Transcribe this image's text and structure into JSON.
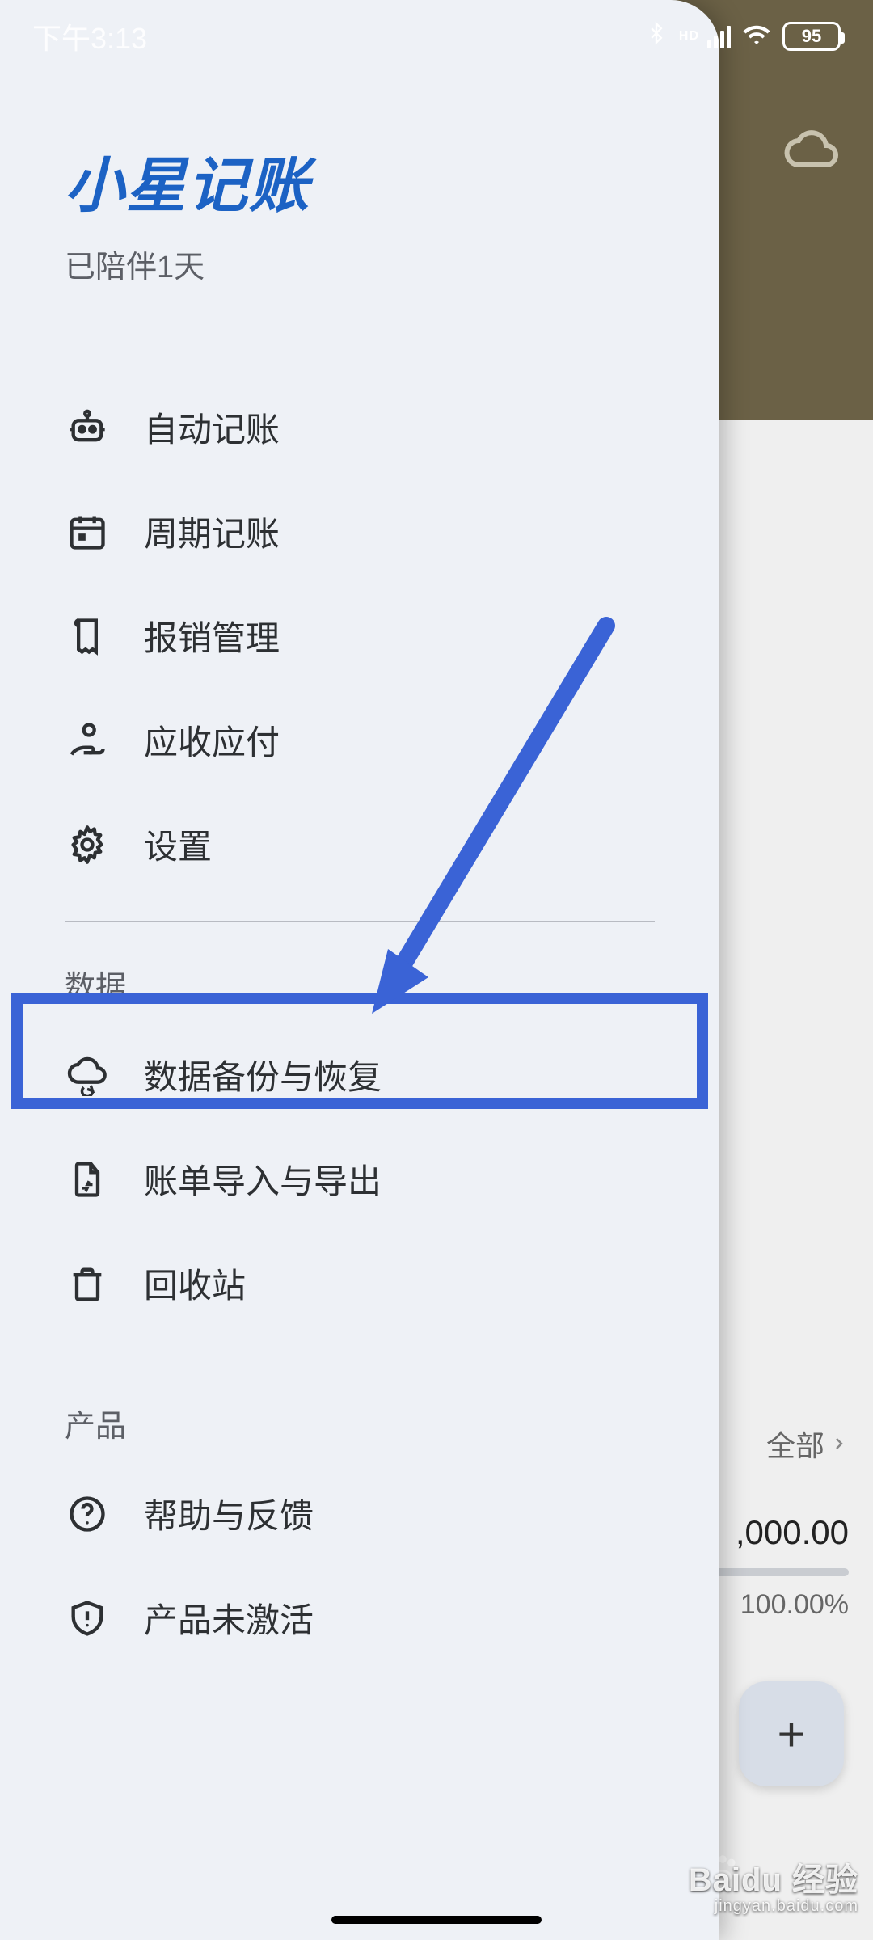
{
  "status": {
    "time": "下午3:13",
    "battery": "95"
  },
  "background": {
    "filter_all": "全部",
    "amount": ",000.00",
    "percent": "100.00%",
    "fab": "+"
  },
  "drawer": {
    "brand_title": "小星记账",
    "brand_sub": "已陪伴1天",
    "sections": {
      "data_label": "数据",
      "product_label": "产品"
    },
    "items": {
      "auto": "自动记账",
      "cycle": "周期记账",
      "reimburse": "报销管理",
      "receivable": "应收应付",
      "settings": "设置",
      "backup": "数据备份与恢复",
      "import": "账单导入与导出",
      "trash": "回收站",
      "help": "帮助与反馈",
      "activate": "产品未激活"
    }
  },
  "watermark": {
    "main": "Baidu 经验",
    "sub": "jingyan.baidu.com"
  }
}
